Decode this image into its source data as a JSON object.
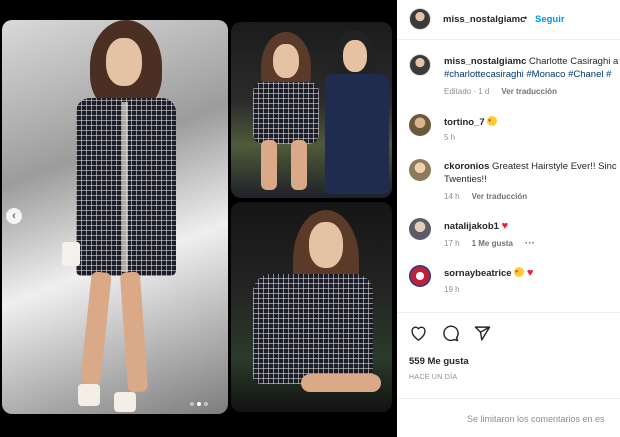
{
  "header": {
    "username": "miss_nostalgiamc",
    "dot": "•",
    "follow": "Seguir"
  },
  "caption": {
    "username": "miss_nostalgiamc",
    "text": "Charlotte Casiraghi a",
    "hashtags": "#charlottecasiraghi #Monaco #Chanel #",
    "edited": "Editado · 1 d",
    "translate": "Ver traducción"
  },
  "comments": [
    {
      "username": "tortino_7",
      "time": "5 h",
      "emoji": "face-hearts"
    },
    {
      "username": "ckoronios",
      "text_line1": "Greatest Hairstyle Ever!! Sinc",
      "text_line2": "Twenties!!",
      "time": "14 h",
      "translate": "Ver traducción"
    },
    {
      "username": "natalijakob1",
      "time": "17 h",
      "likes": "1 Me gusta",
      "more": "···",
      "emoji": "red-heart"
    },
    {
      "username": "sornaybeatrice",
      "time": "19 h",
      "emoji": "face-hearts+red-heart"
    }
  ],
  "actions": {
    "like_icon": "heart-icon",
    "comment_icon": "comment-icon",
    "share_icon": "share-icon"
  },
  "likes": "559 Me gusta",
  "posted": "HACE UN DÍA",
  "footer": "Se limitaron los comentarios en es",
  "colors": {
    "link": "#0095f6",
    "hashtag": "#00376b",
    "heart": "#ed1d3a",
    "emoji": "#ffcc33"
  }
}
